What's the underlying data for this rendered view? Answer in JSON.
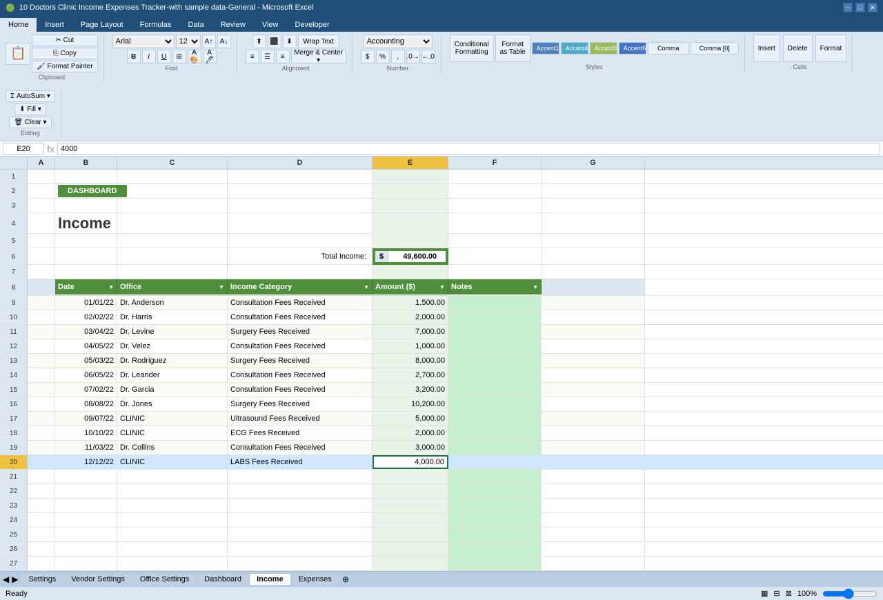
{
  "titlebar": {
    "title": "10 Doctors Clinic Income Expenses Tracker-with sample data-General - Microsoft Excel"
  },
  "formula_bar": {
    "cell_ref": "E20",
    "formula": "4000"
  },
  "ribbon": {
    "tabs": [
      "Home",
      "Insert",
      "Page Layout",
      "Formulas",
      "Data",
      "Review",
      "View",
      "Developer"
    ],
    "active_tab": "Home"
  },
  "dashboard_button": "DASHBOARD",
  "income_title": "Income",
  "total_income_label": "Total Income:",
  "total_income_dollar": "$",
  "total_income_value": "49,600.00",
  "col_headers": [
    "A",
    "B",
    "C",
    "D",
    "E",
    "F",
    "G"
  ],
  "table_headers": {
    "date": "Date",
    "office": "Office",
    "income_category": "Income Category",
    "amount": "Amount ($)",
    "notes": "Notes"
  },
  "rows": [
    {
      "date": "01/01/22",
      "office": "Dr. Anderson",
      "category": "Consultation Fees Received",
      "amount": "1,500.00"
    },
    {
      "date": "02/02/22",
      "office": "Dr. Harris",
      "category": "Consultation Fees Received",
      "amount": "2,000.00"
    },
    {
      "date": "03/04/22",
      "office": "Dr. Levine",
      "category": "Surgery Fees Received",
      "amount": "7,000.00"
    },
    {
      "date": "04/05/22",
      "office": "Dr. Velez",
      "category": "Consultation Fees Received",
      "amount": "1,000.00"
    },
    {
      "date": "05/03/22",
      "office": "Dr. Rodriguez",
      "category": "Surgery Fees Received",
      "amount": "8,000.00"
    },
    {
      "date": "06/05/22",
      "office": "Dr. Leander",
      "category": "Consultation Fees Received",
      "amount": "2,700.00"
    },
    {
      "date": "07/02/22",
      "office": "Dr. Garcia",
      "category": "Consultation Fees Received",
      "amount": "3,200.00"
    },
    {
      "date": "08/08/22",
      "office": "Dr. Jones",
      "category": "Surgery Fees Received",
      "amount": "10,200.00"
    },
    {
      "date": "09/07/22",
      "office": "CLINIC",
      "category": "Ultrasound Fees Received",
      "amount": "5,000.00"
    },
    {
      "date": "10/10/22",
      "office": "CLINIC",
      "category": "ECG Fees Received",
      "amount": "2,000.00"
    },
    {
      "date": "11/03/22",
      "office": "Dr. Collins",
      "category": "Consultation Fees Received",
      "amount": "3,000.00"
    },
    {
      "date": "12/12/22",
      "office": "CLINIC",
      "category": "LABS Fees Received",
      "amount": "4,000.00"
    }
  ],
  "sheet_tabs": [
    "Settings",
    "Vendor Settings",
    "Office Settings",
    "Dashboard",
    "Income",
    "Expenses"
  ],
  "active_sheet": "Income",
  "status": "Ready",
  "zoom": "100%"
}
